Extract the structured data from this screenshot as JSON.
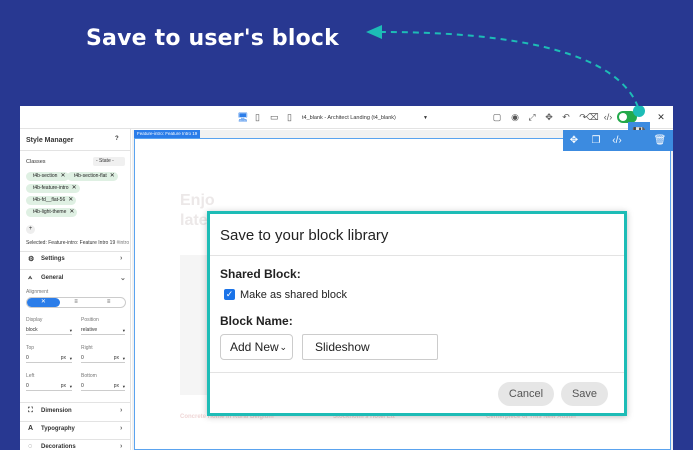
{
  "headline": "Save to user's block",
  "topbar": {
    "page_select": "t4_blank - Architect Landing (t4_blank)"
  },
  "sidebar": {
    "title": "Style Manager",
    "help": "?",
    "classes_label": "Classes",
    "state_select": "- State -",
    "tags": [
      "t4b-section",
      "t4b-section-flat",
      "t4b-feature-intro",
      "t4b-fd__flat-56",
      "t4b-light-theme"
    ],
    "add_class": "+",
    "selected_prefix": "Selected:",
    "selected_value": "Feature-intro: Feature Intro 19",
    "selected_suffix": "#intro",
    "sections": {
      "settings": "Settings",
      "general": "General",
      "dimension": "Dimension",
      "typography": "Typography",
      "decorations": "Decorations"
    },
    "alignment_label": "Alignment",
    "fields": {
      "display_label": "Display",
      "display_value": "block",
      "position_label": "Position",
      "position_value": "relative",
      "top_label": "Top",
      "top_value": "0",
      "right_label": "Right",
      "right_value": "0",
      "left_label": "Left",
      "left_value": "0",
      "bottom_label": "Bottom",
      "bottom_value": "0",
      "unit": "px"
    }
  },
  "canvas": {
    "frame_badge": "Feature-intro: Feature Intro 19",
    "ghost_heading_1": "Enjo",
    "ghost_heading_2": "late",
    "captions": [
      "Concrete Home in Rural Belgium",
      "Stockholm's Hotel Ett",
      "Centerpiece of This New Austin"
    ]
  },
  "modal": {
    "title": "Save to your block library",
    "shared_label": "Shared Block:",
    "checkbox_label": "Make as shared block",
    "checkbox_checked": true,
    "name_label": "Block Name:",
    "select_value": "Add New",
    "name_value": "Slideshow",
    "cancel": "Cancel",
    "save": "Save"
  },
  "colors": {
    "background": "#283891",
    "accent_teal": "#1dbcb6",
    "accent_blue": "#3c8be0",
    "checkbox_blue": "#1a73e8"
  }
}
